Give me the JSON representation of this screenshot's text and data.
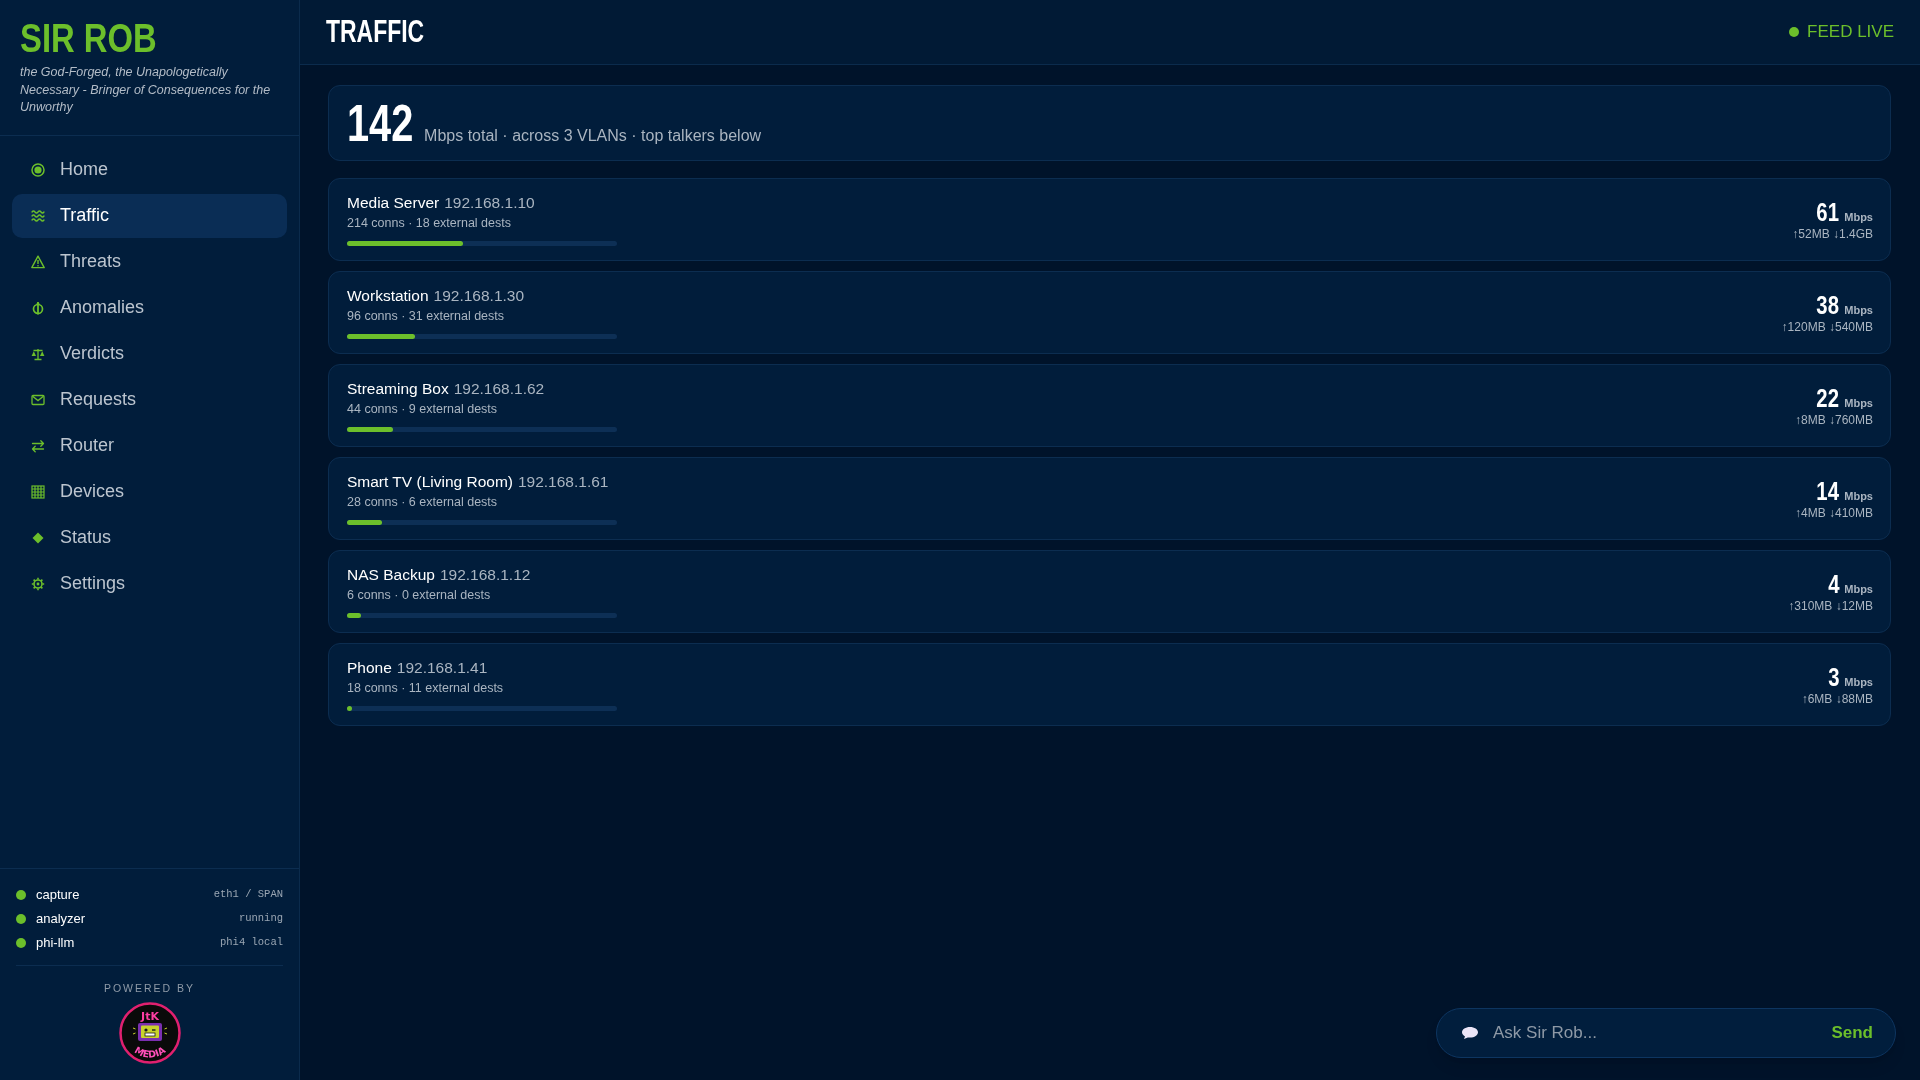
{
  "sidebar": {
    "title": "SIR ROB",
    "tagline": "the God-Forged, the Unapologetically Necessary - Bringer of Consequences for the Unworthy",
    "items": [
      {
        "label": "Home",
        "selected": false
      },
      {
        "label": "Traffic",
        "selected": true
      },
      {
        "label": "Threats",
        "selected": false
      },
      {
        "label": "Anomalies",
        "selected": false
      },
      {
        "label": "Verdicts",
        "selected": false
      },
      {
        "label": "Requests",
        "selected": false
      },
      {
        "label": "Router",
        "selected": false
      },
      {
        "label": "Devices",
        "selected": false
      },
      {
        "label": "Status",
        "selected": false
      },
      {
        "label": "Settings",
        "selected": false
      }
    ],
    "services": [
      {
        "name": "capture",
        "detail": "eth1 / SPAN",
        "color": "#6cbf2b"
      },
      {
        "name": "analyzer",
        "detail": "running",
        "color": "#6cbf2b"
      },
      {
        "name": "phi-llm",
        "detail": "phi4 local",
        "color": "#6cbf2b"
      }
    ],
    "powered_by": {
      "label": "POWERED BY",
      "logo_top": "JtK",
      "logo_bottom": "MEDIA"
    }
  },
  "header": {
    "title": "TRAFFIC",
    "feed_status": "FEED LIVE"
  },
  "summary": {
    "value": "142",
    "caption": "Mbps total · across 3 VLANs · top talkers below"
  },
  "devices": [
    {
      "name": "Media Server",
      "ip": "192.168.1.10",
      "details": "214 conns · 18 external dests",
      "level": 0.43,
      "rate": "61",
      "unit": "Mbps",
      "transfer": "↑52MB ↓1.4GB"
    },
    {
      "name": "Workstation",
      "ip": "192.168.1.30",
      "details": "96 conns · 31 external dests",
      "level": 0.25,
      "rate": "38",
      "unit": "Mbps",
      "transfer": "↑120MB ↓540MB"
    },
    {
      "name": "Streaming Box",
      "ip": "192.168.1.62",
      "details": "44 conns · 9 external dests",
      "level": 0.17,
      "rate": "22",
      "unit": "Mbps",
      "transfer": "↑8MB ↓760MB"
    },
    {
      "name": "Smart TV (Living Room)",
      "ip": "192.168.1.61",
      "details": "28 conns · 6 external dests",
      "level": 0.13,
      "rate": "14",
      "unit": "Mbps",
      "transfer": "↑4MB ↓410MB"
    },
    {
      "name": "NAS Backup",
      "ip": "192.168.1.12",
      "details": "6 conns · 0 external dests",
      "level": 0.05,
      "rate": "4",
      "unit": "Mbps",
      "transfer": "↑310MB ↓12MB"
    },
    {
      "name": "Phone",
      "ip": "192.168.1.41",
      "details": "18 conns · 11 external dests",
      "level": 0.02,
      "rate": "3",
      "unit": "Mbps",
      "transfer": "↑6MB ↓88MB"
    }
  ],
  "chat": {
    "placeholder": "Ask Sir Rob...",
    "send": "Send"
  }
}
